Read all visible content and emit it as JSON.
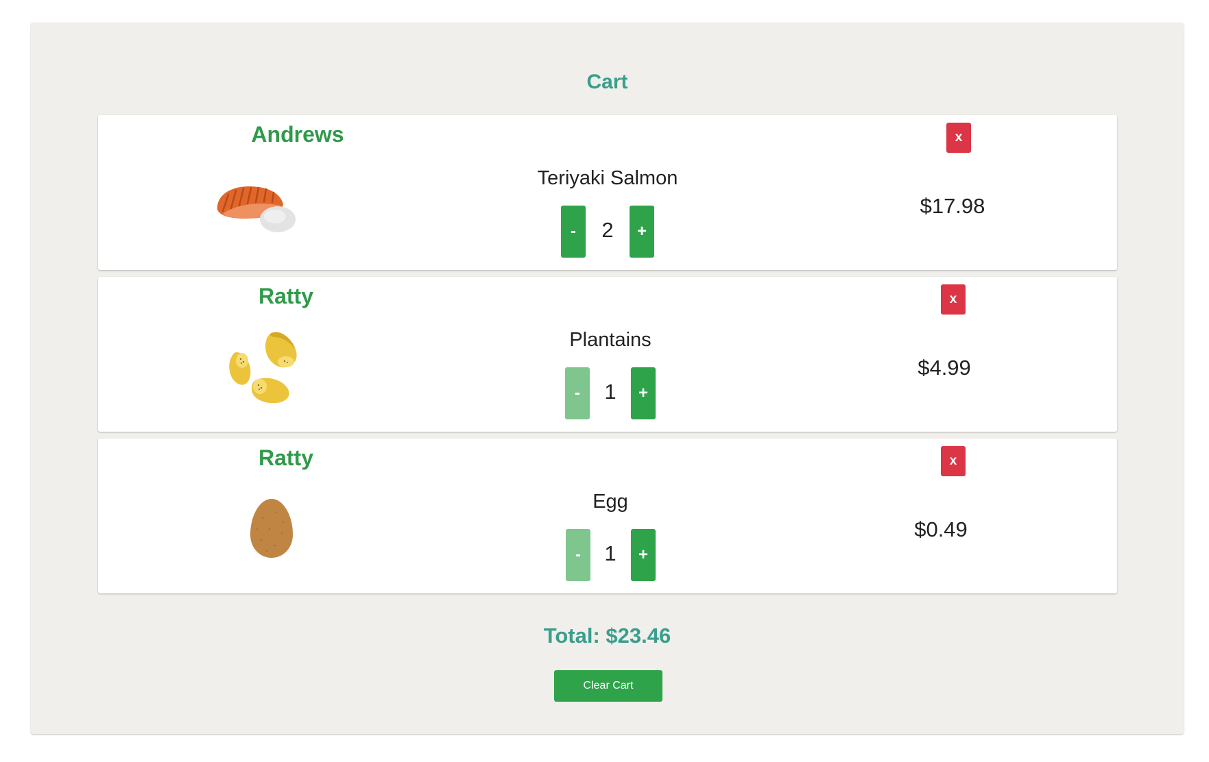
{
  "cart": {
    "title": "Cart",
    "items": [
      {
        "dining_hall": "Andrews",
        "food_icon": "teriyaki-salmon-icon",
        "name": "Teriyaki Salmon",
        "quantity": "2",
        "decrement_label": "-",
        "increment_label": "+",
        "decrement_enabled": true,
        "remove_label": "x",
        "price": "$17.98"
      },
      {
        "dining_hall": "Ratty",
        "food_icon": "plantains-icon",
        "name": "Plantains",
        "quantity": "1",
        "decrement_label": "-",
        "increment_label": "+",
        "decrement_enabled": false,
        "remove_label": "x",
        "price": "$4.99"
      },
      {
        "dining_hall": "Ratty",
        "food_icon": "egg-icon",
        "name": "Egg",
        "quantity": "1",
        "decrement_label": "-",
        "increment_label": "+",
        "decrement_enabled": false,
        "remove_label": "x",
        "price": "$0.49"
      }
    ],
    "total": "Total: $23.46",
    "clear_label": "Clear Cart"
  },
  "colors": {
    "panel_background": "#f0efeb",
    "title_teal": "#3a9e8c",
    "dining_hall_green": "#2f9a4a",
    "button_green": "#2fa34a",
    "button_green_disabled": "#7fc58e",
    "remove_red": "#dc3545"
  }
}
